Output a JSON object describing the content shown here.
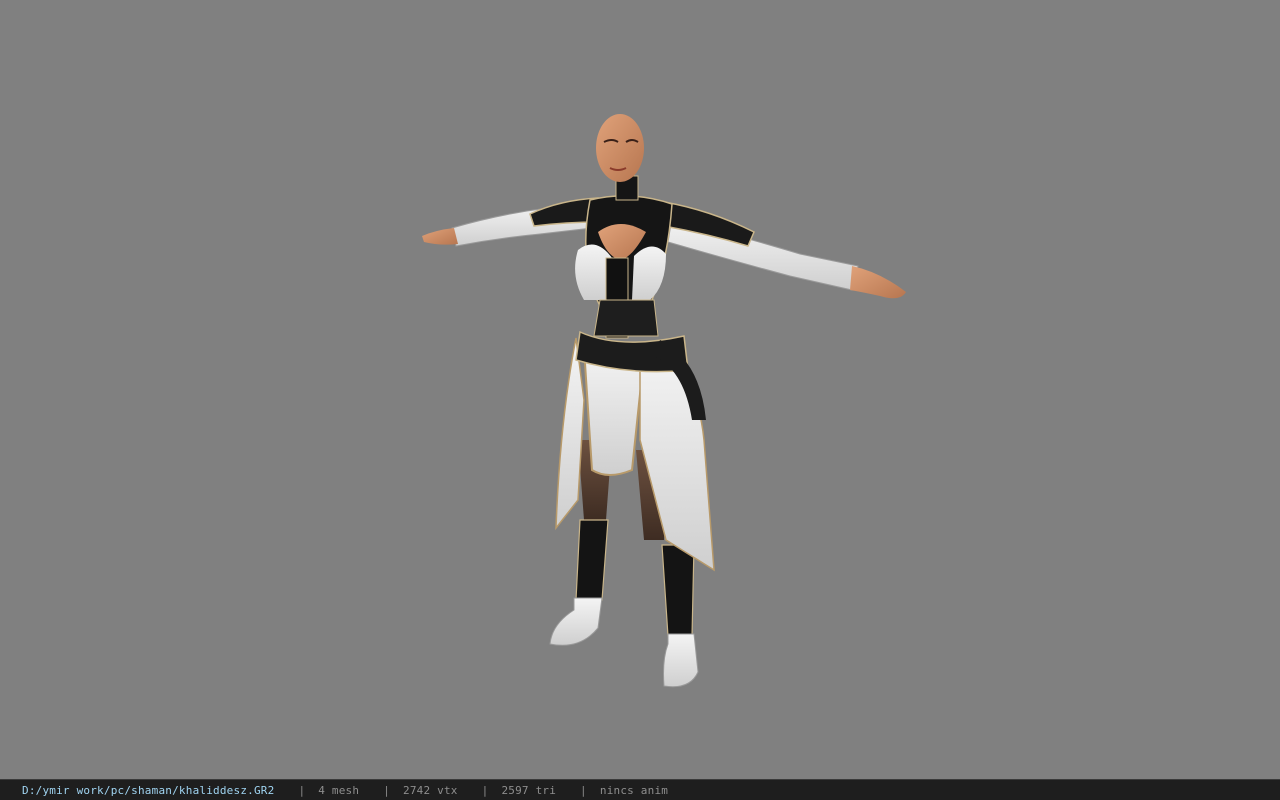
{
  "viewport": {
    "background": "#808080",
    "subject": "character-model"
  },
  "status": {
    "file_path": "D:/ymir work/pc/shaman/khaliddesz.GR2",
    "separator": "|",
    "mesh_count": "4 mesh",
    "vertex_count": "2742 vtx",
    "triangle_count": "2597 tri",
    "animation": "nincs anim"
  },
  "colors": {
    "status_bg": "#1e1e1e",
    "path_text": "#9fd3f0",
    "stat_text": "#8e8e8e"
  }
}
